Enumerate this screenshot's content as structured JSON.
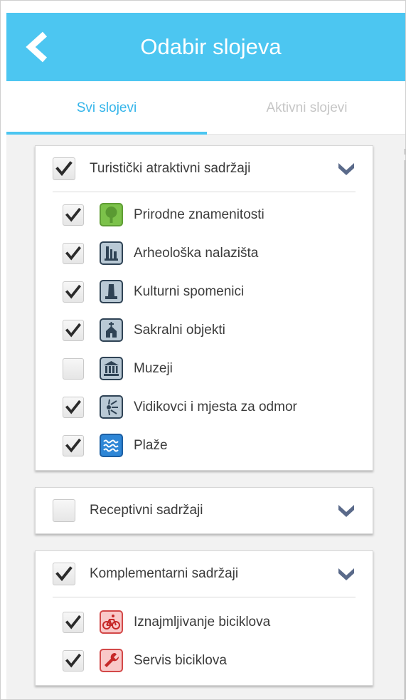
{
  "header": {
    "title": "Odabir slojeva",
    "back_icon": "chevron-left-icon"
  },
  "tabs": [
    {
      "label": "Svi slojevi",
      "selected": true
    },
    {
      "label": "Aktivni slojevi",
      "selected": false
    }
  ],
  "colors": {
    "accent": "#4cc6f1",
    "tab_selected": "#35b5ea",
    "tab_inactive": "#c6c6c6",
    "chevron": "#5a6a8a"
  },
  "groups": [
    {
      "title": "Turistički atraktivni sadržaji",
      "checked": true,
      "expanded": true,
      "items": [
        {
          "label": "Prirodne znamenitosti",
          "checked": true,
          "icon": "tree-icon",
          "icon_color": "#7cc24a"
        },
        {
          "label": "Arheološka nalazišta",
          "checked": true,
          "icon": "ruins-icon",
          "icon_color": "#b9c9d5"
        },
        {
          "label": "Kulturni spomenici",
          "checked": true,
          "icon": "monument-icon",
          "icon_color": "#b9c9d5"
        },
        {
          "label": "Sakralni objekti",
          "checked": true,
          "icon": "church-icon",
          "icon_color": "#b9c9d5"
        },
        {
          "label": "Muzeji",
          "checked": false,
          "icon": "museum-icon",
          "icon_color": "#b9c9d5"
        },
        {
          "label": "Vidikovci i mjesta za odmor",
          "checked": true,
          "icon": "viewpoint-icon",
          "icon_color": "#b9c9d5"
        },
        {
          "label": "Plaže",
          "checked": true,
          "icon": "beach-waves-icon",
          "icon_color": "#2e86d6"
        }
      ]
    },
    {
      "title": "Receptivni sadržaji",
      "checked": false,
      "expanded": false,
      "items": []
    },
    {
      "title": "Komplementarni sadržaji",
      "checked": true,
      "expanded": true,
      "items": [
        {
          "label": "Iznajmljivanje biciklova",
          "checked": true,
          "icon": "bicycle-icon",
          "icon_color": "#f28a8a"
        },
        {
          "label": "Servis biciklova",
          "checked": true,
          "icon": "wrench-icon",
          "icon_color": "#f28a8a"
        }
      ]
    }
  ]
}
